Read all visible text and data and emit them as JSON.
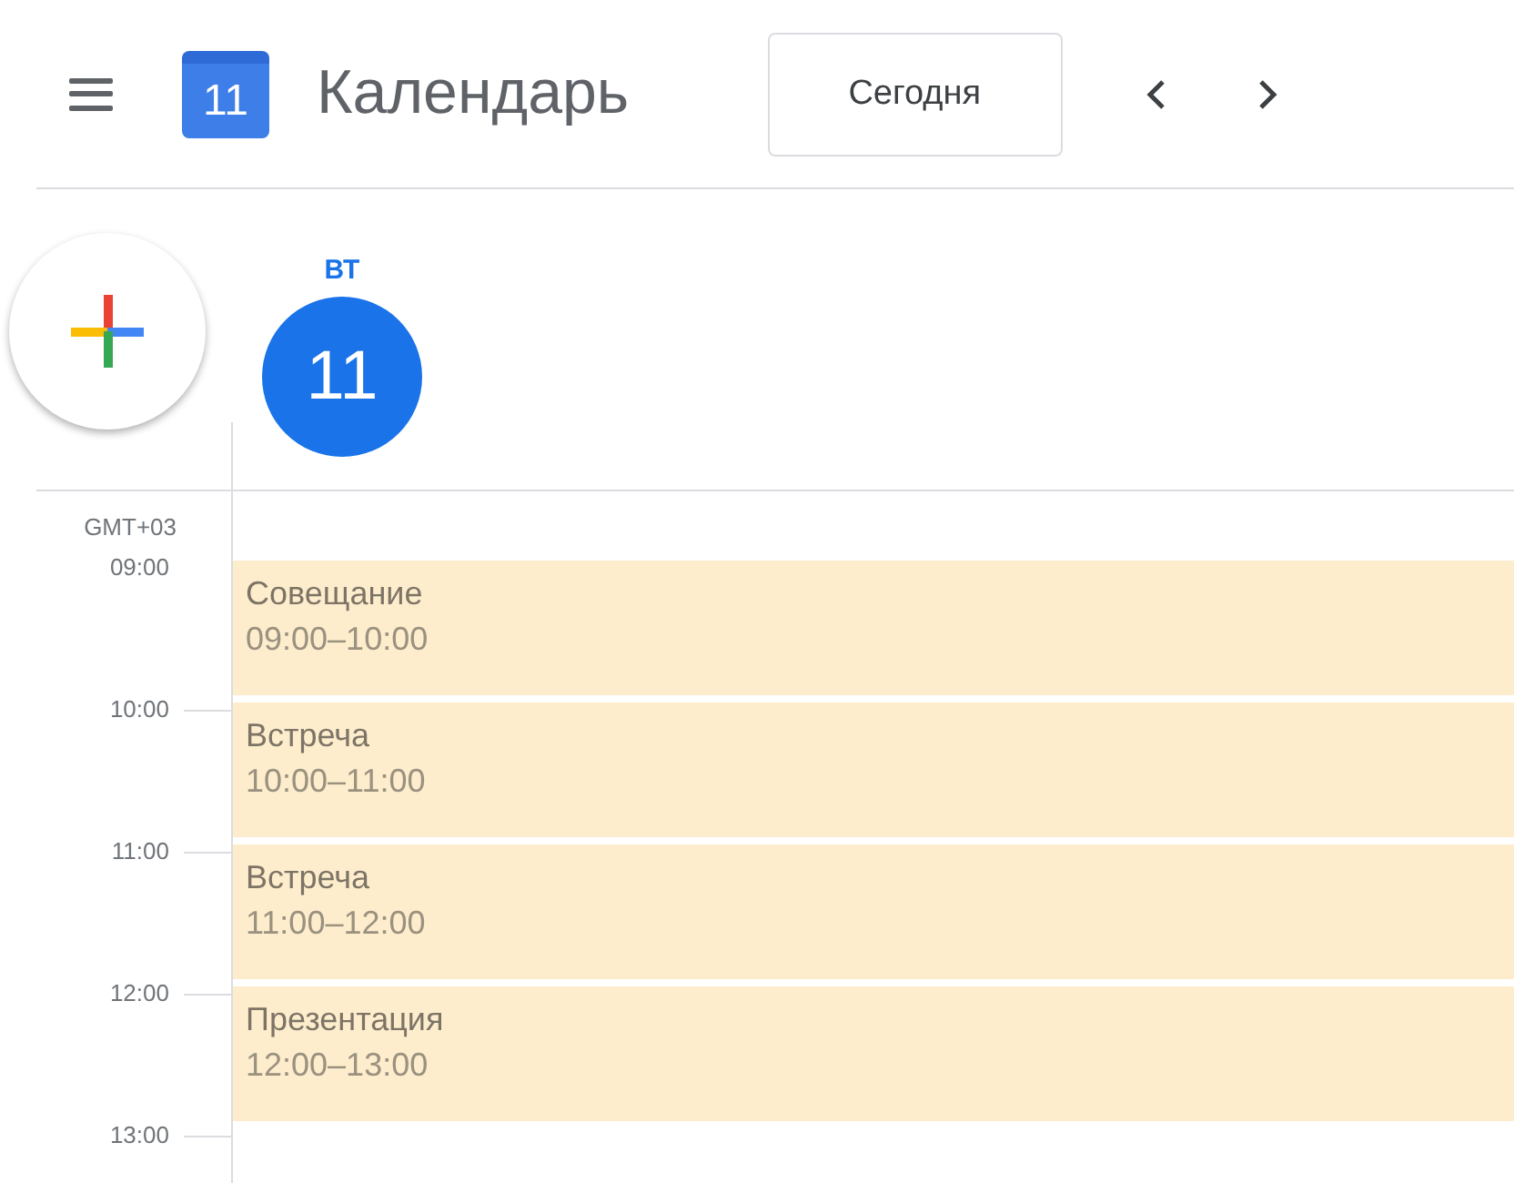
{
  "header": {
    "app_title": "Календарь",
    "logo_day": "11",
    "today_button": "Сегодня"
  },
  "day": {
    "weekday": "ВТ",
    "date": "11",
    "selected": true
  },
  "timezone": "GMT+03",
  "hours": [
    "09:00",
    "10:00",
    "11:00",
    "12:00",
    "13:00"
  ],
  "events": [
    {
      "title": "Совещание",
      "time": "09:00–10:00",
      "color": "#fdedcd"
    },
    {
      "title": "Встреча",
      "time": "10:00–11:00",
      "color": "#fdedcd"
    },
    {
      "title": "Встреча",
      "time": "11:00–12:00",
      "color": "#fdedcd"
    },
    {
      "title": "Презентация",
      "time": "12:00–13:00",
      "color": "#fdedcd"
    }
  ]
}
